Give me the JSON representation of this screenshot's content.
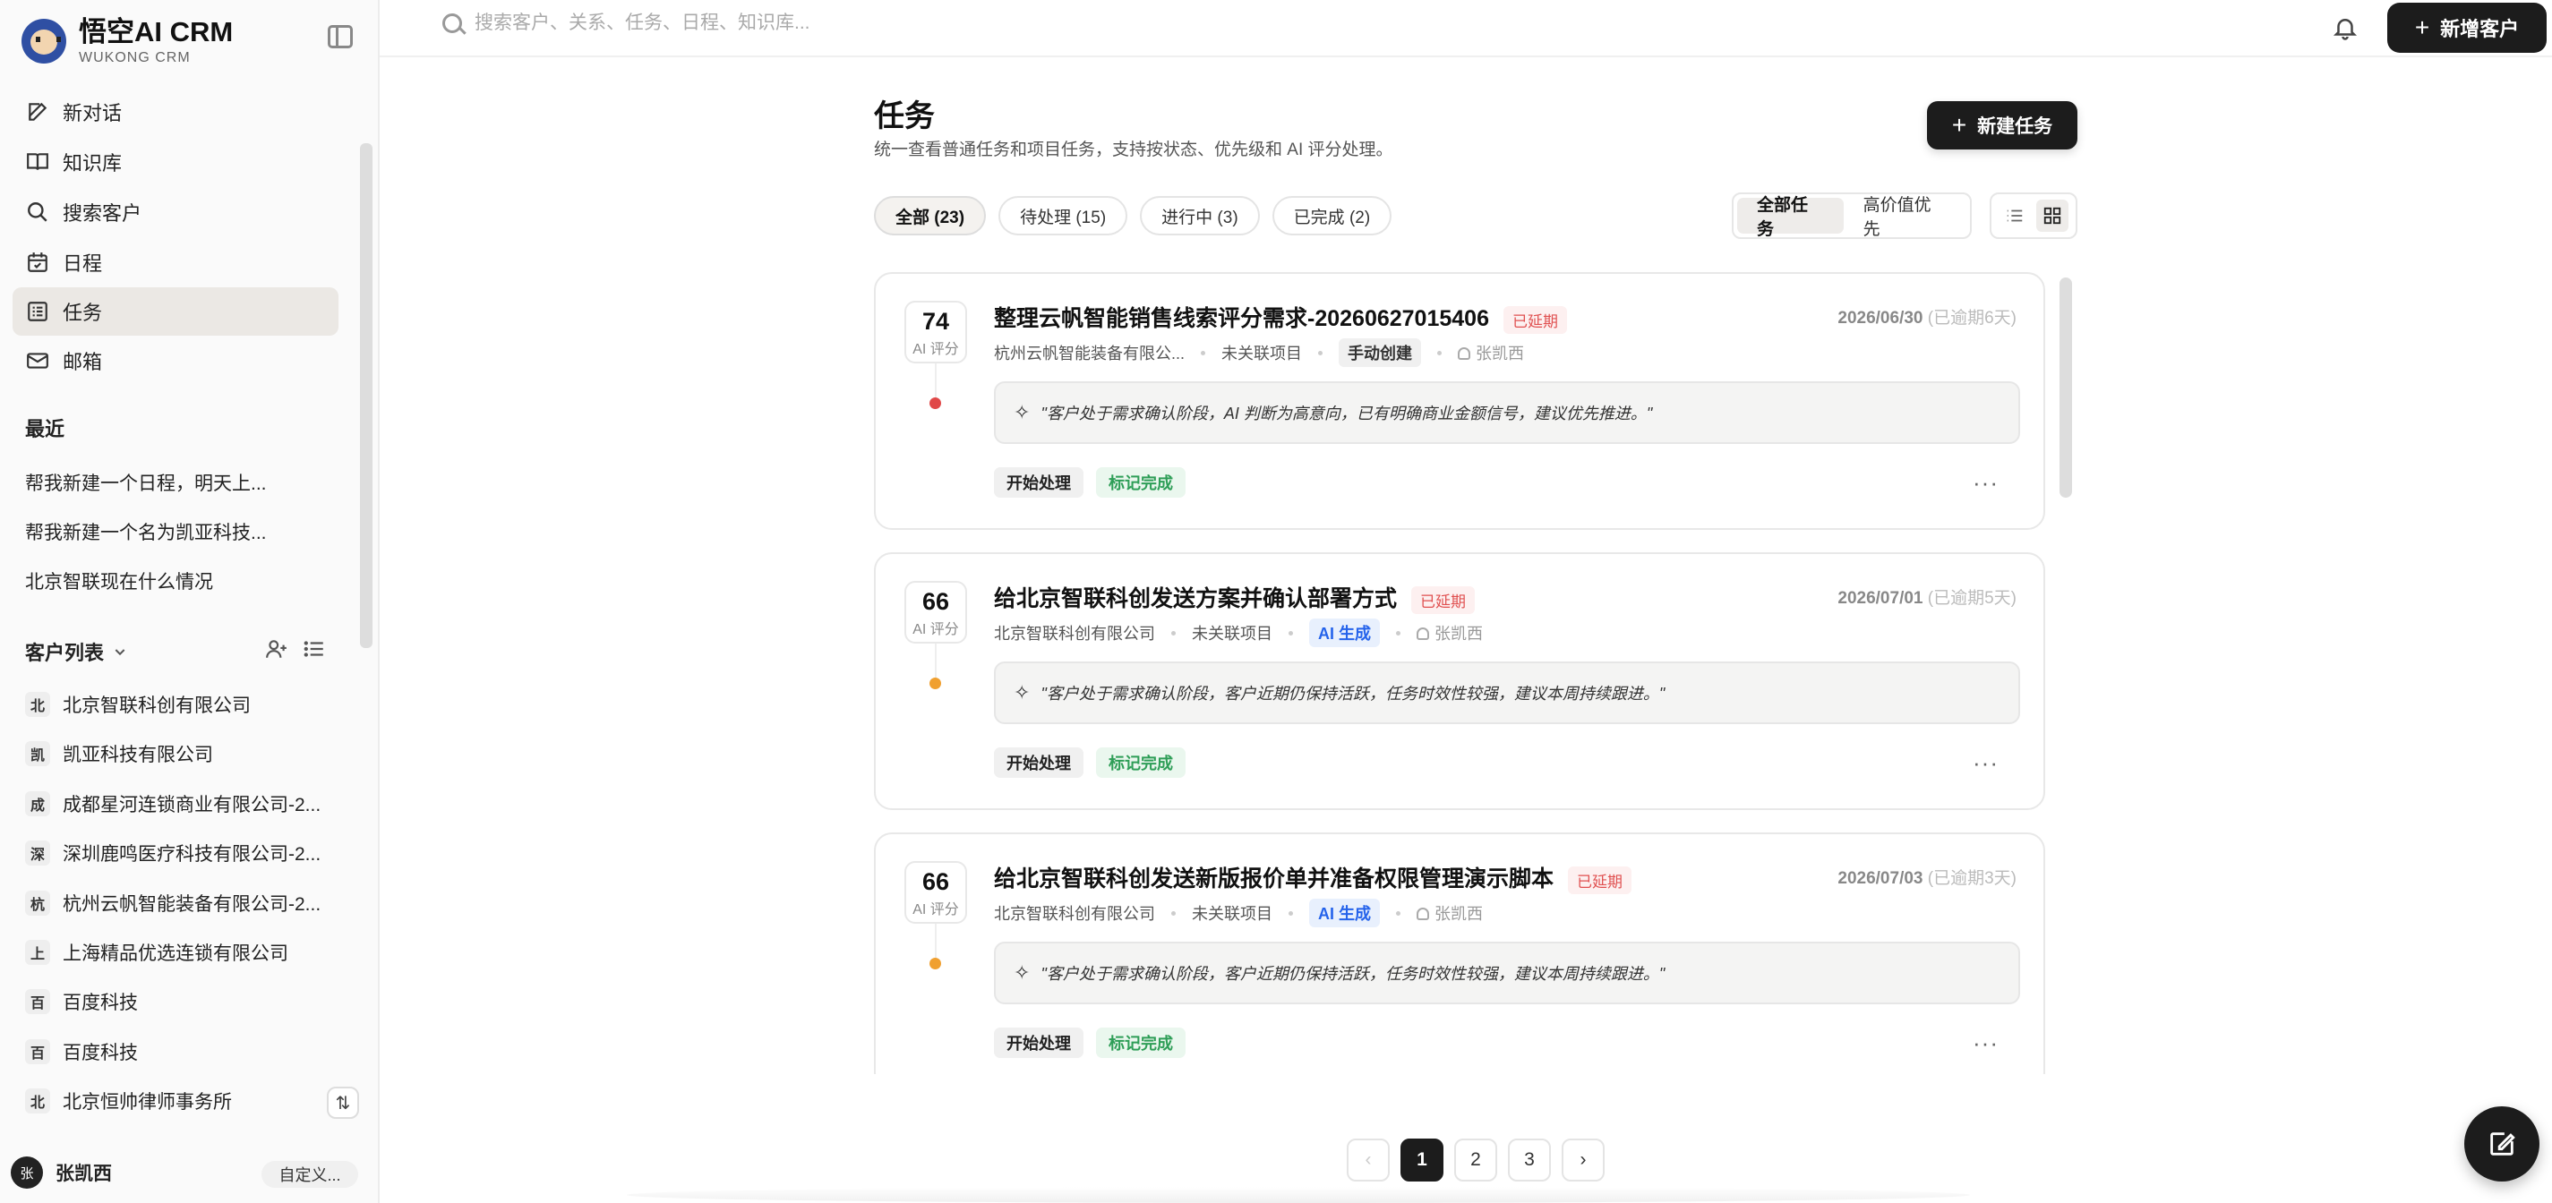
{
  "brand": {
    "title": "悟空AI CRM",
    "subtitle": "WUKONG CRM"
  },
  "nav": [
    {
      "label": "新对话",
      "icon": "edit-icon"
    },
    {
      "label": "知识库",
      "icon": "book-icon"
    },
    {
      "label": "搜索客户",
      "icon": "search-icon"
    },
    {
      "label": "日程",
      "icon": "calendar-icon"
    },
    {
      "label": "任务",
      "icon": "task-list-icon",
      "active": true
    },
    {
      "label": "邮箱",
      "icon": "mail-icon"
    }
  ],
  "recent": {
    "title": "最近",
    "items": [
      "帮我新建一个日程，明天上...",
      "帮我新建一个名为凯亚科技...",
      "北京智联现在什么情况"
    ]
  },
  "customers": {
    "title": "客户列表",
    "items": [
      {
        "badge": "北",
        "name": "北京智联科创有限公司"
      },
      {
        "badge": "凯",
        "name": "凯亚科技有限公司"
      },
      {
        "badge": "成",
        "name": "成都星河连锁商业有限公司-2..."
      },
      {
        "badge": "深",
        "name": "深圳鹿鸣医疗科技有限公司-2..."
      },
      {
        "badge": "杭",
        "name": "杭州云帆智能装备有限公司-2..."
      },
      {
        "badge": "上",
        "name": "上海精品优选连锁有限公司"
      },
      {
        "badge": "百",
        "name": "百度科技"
      },
      {
        "badge": "百",
        "name": "百度科技"
      },
      {
        "badge": "北",
        "name": "北京恒帅律师事务所"
      }
    ]
  },
  "user": {
    "avatar": "张",
    "name": "张凯西",
    "custom_label": "自定义..."
  },
  "topbar": {
    "search_placeholder": "搜索客户、关系、任务、日程、知识库...",
    "new_customer": "新增客户"
  },
  "page": {
    "title": "任务",
    "subtitle": "统一查看普通任务和项目任务，支持按状态、优先级和 AI 评分处理。",
    "new_task": "新建任务"
  },
  "filters": [
    "全部 (23)",
    "待处理 (15)",
    "进行中 (3)",
    "已完成 (2)"
  ],
  "segments": [
    "全部任务",
    "高价值优先"
  ],
  "tasks": [
    {
      "score": "74",
      "score_label": "AI 评分",
      "dot_color": "#e04848",
      "title": "整理云帆智能销售线索评分需求-20260627015406",
      "status": "已延期",
      "date": "2026/06/30",
      "late": "(已逾期6天)",
      "company": "杭州云帆智能装备有限公...",
      "project": "未关联项目",
      "source": "手动创建",
      "source_ai": false,
      "owner": "张凯西",
      "insight": "\"客户处于需求确认阶段，AI 判断为高意向，已有明确商业金额信号，建议优先推进。\"",
      "start": "开始处理",
      "done": "标记完成"
    },
    {
      "score": "66",
      "score_label": "AI 评分",
      "dot_color": "#f0a030",
      "title": "给北京智联科创发送方案并确认部署方式",
      "status": "已延期",
      "date": "2026/07/01",
      "late": "(已逾期5天)",
      "company": "北京智联科创有限公司",
      "project": "未关联项目",
      "source": "AI 生成",
      "source_ai": true,
      "owner": "张凯西",
      "insight": "\"客户处于需求确认阶段，客户近期仍保持活跃，任务时效性较强，建议本周持续跟进。\"",
      "start": "开始处理",
      "done": "标记完成"
    },
    {
      "score": "66",
      "score_label": "AI 评分",
      "dot_color": "#f0a030",
      "title": "给北京智联科创发送新版报价单并准备权限管理演示脚本",
      "status": "已延期",
      "date": "2026/07/03",
      "late": "(已逾期3天)",
      "company": "北京智联科创有限公司",
      "project": "未关联项目",
      "source": "AI 生成",
      "source_ai": true,
      "owner": "张凯西",
      "insight": "\"客户处于需求确认阶段，客户近期仍保持活跃，任务时效性较强，建议本周持续跟进。\"",
      "start": "开始处理",
      "done": "标记完成"
    }
  ],
  "pagination": {
    "pages": [
      "1",
      "2",
      "3"
    ],
    "current": "1",
    "prev": "‹",
    "next": "›"
  }
}
